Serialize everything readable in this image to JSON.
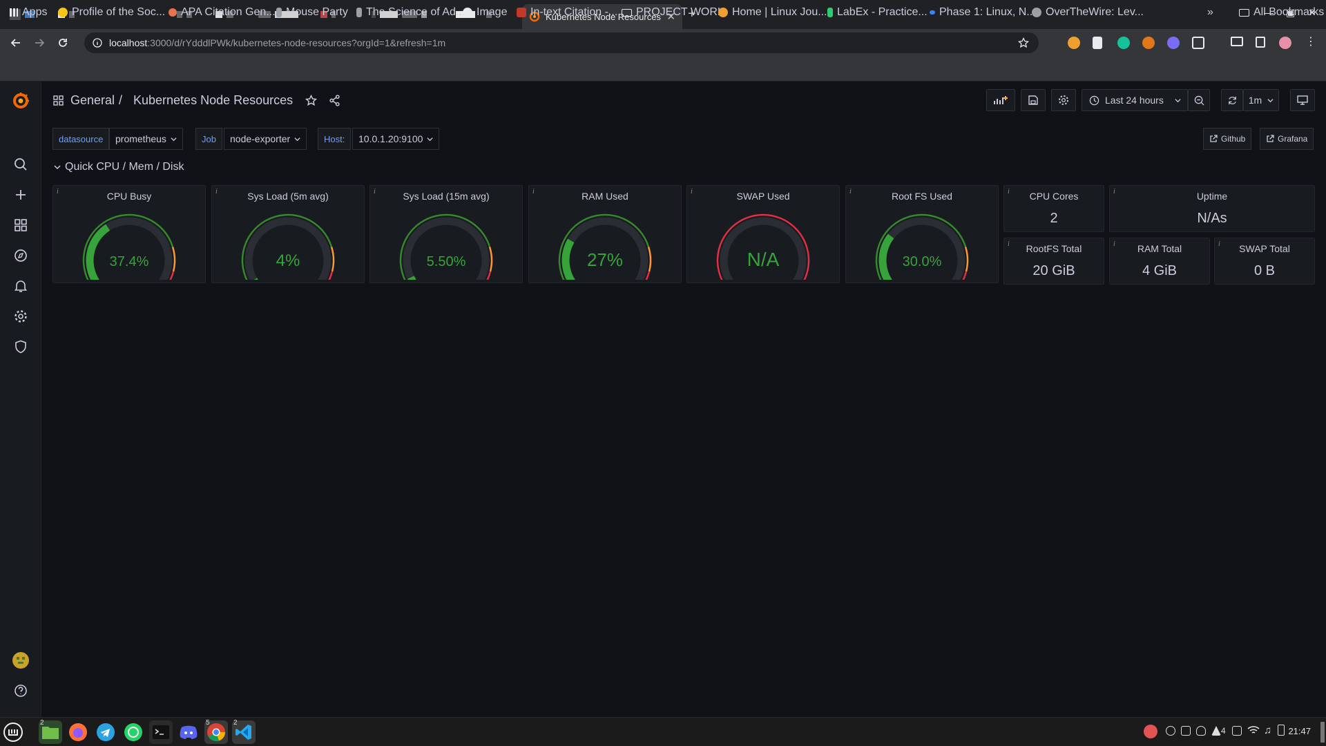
{
  "browser": {
    "active_tab_title": "Kubernetes Node Resources",
    "url_host": "localhost",
    "url_path": ":3000/d/rYdddlPWk/kubernetes-node-resources?orgId=1&refresh=1m",
    "bookmarks": [
      {
        "label": "Apps",
        "icon": "apps-grid-icon",
        "color": "#ffffff"
      },
      {
        "label": "Profile of the Soc...",
        "icon": "emoji-icon",
        "color": "#f5c518"
      },
      {
        "label": "APA Citation Gen...",
        "icon": "citation-icon",
        "color": "#e8744f"
      },
      {
        "label": "Mouse Party",
        "icon": "mouse-icon",
        "color": "#9aa0a6"
      },
      {
        "label": "The Science of Ad...",
        "icon": "science-icon",
        "color": "#9aa0a6"
      },
      {
        "label": "Image",
        "icon": "globe-icon",
        "color": "#e8eaed"
      },
      {
        "label": "In-text Citation -...",
        "icon": "citation-book-icon",
        "color": "#c0392b"
      },
      {
        "label": "PROJECT WORK",
        "icon": "folder-icon",
        "color": "#e8eaed"
      },
      {
        "label": "Home | Linux Jou...",
        "icon": "linux-icon",
        "color": "#f0a030"
      },
      {
        "label": "LabEx - Practice...",
        "icon": "labex-icon",
        "color": "#2ecc71"
      },
      {
        "label": "Phase 1: Linux, N...",
        "icon": "phase-icon",
        "color": "#3b82f6"
      },
      {
        "label": "OverTheWire: Lev...",
        "icon": "overthewire-icon",
        "color": "#9aa0a6"
      }
    ],
    "more_bookmarks": "»",
    "all_bookmarks": "All Bookmarks"
  },
  "grafana": {
    "breadcrumb_parent": "General",
    "breadcrumb_sep": "/",
    "dashboard_title": "Kubernetes Node Resources",
    "time_range": "Last 24 hours",
    "refresh_interval": "1m",
    "variables": [
      {
        "label": "datasource",
        "value": "prometheus"
      },
      {
        "label": "Job",
        "value": "node-exporter"
      },
      {
        "label": "Host:",
        "value": "10.0.1.20:9100"
      }
    ],
    "links": [
      {
        "label": "Github"
      },
      {
        "label": "Grafana"
      }
    ],
    "row_title": "Quick CPU / Mem / Disk",
    "gauges": [
      {
        "title": "CPU Busy",
        "value_text": "37.4%",
        "percent": 37.4,
        "color": "#37872d",
        "text_color": "#37a33b",
        "value_size": 20
      },
      {
        "title": "Sys Load (5m avg)",
        "value_text": "4%",
        "percent": 4,
        "color": "#37872d",
        "text_color": "#37a33b",
        "value_size": 24
      },
      {
        "title": "Sys Load (15m avg)",
        "value_text": "5.50%",
        "percent": 5.5,
        "color": "#37872d",
        "text_color": "#37a33b",
        "value_size": 20
      },
      {
        "title": "RAM Used",
        "value_text": "27%",
        "percent": 27,
        "color": "#37872d",
        "text_color": "#37a33b",
        "value_size": 26
      },
      {
        "title": "SWAP Used",
        "value_text": "N/A",
        "percent": 0,
        "color": "#e02f44",
        "text_color": "#37a33b",
        "value_size": 28
      },
      {
        "title": "Root FS Used",
        "value_text": "30.0%",
        "percent": 30,
        "color": "#37872d",
        "text_color": "#37a33b",
        "value_size": 20
      }
    ],
    "stats": [
      {
        "title": "CPU Cores",
        "value": "2"
      },
      {
        "title": "Uptime",
        "value": "N/As"
      },
      {
        "title": "RootFS Total",
        "value": "20 GiB"
      },
      {
        "title": "RAM Total",
        "value": "4 GiB"
      },
      {
        "title": "SWAP Total",
        "value": "0 B"
      }
    ],
    "panel_info": "i"
  },
  "taskbar": {
    "clock": "21:47",
    "badges": [
      "2",
      "5",
      "2"
    ],
    "tray_count": "4"
  }
}
